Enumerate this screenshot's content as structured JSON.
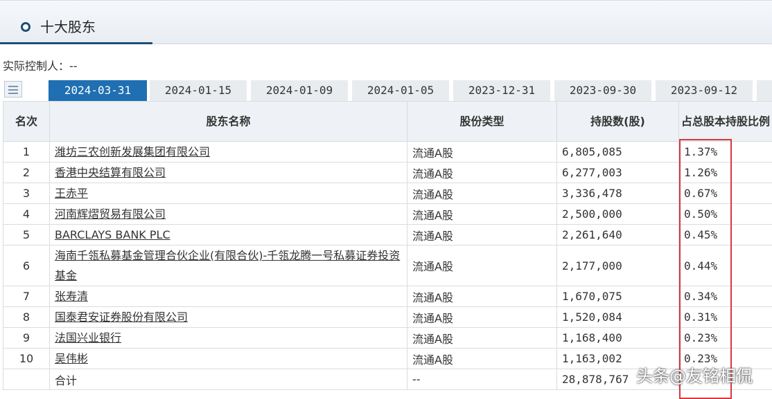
{
  "section": {
    "title": "十大股东"
  },
  "controller": "实际控制人：--",
  "tabs": [
    "2024-03-31",
    "2024-01-15",
    "2024-01-09",
    "2024-01-05",
    "2023-12-31",
    "2023-09-30",
    "2023-09-12"
  ],
  "active_tab": "2024-03-31",
  "table": {
    "headers": {
      "rank": "名次",
      "name": "股东名称",
      "type": "股份类型",
      "shares": "持股数(股)",
      "ratio": "占总股本持股比例"
    },
    "rows": [
      {
        "rank": "1",
        "name": "潍坊三农创新发展集团有限公司",
        "type": "流通A股",
        "shares": "6,805,085",
        "ratio": "1.37%"
      },
      {
        "rank": "2",
        "name": "香港中央结算有限公司",
        "type": "流通A股",
        "shares": "6,277,003",
        "ratio": "1.26%"
      },
      {
        "rank": "3",
        "name": "王赤平",
        "type": "流通A股",
        "shares": "3,336,478",
        "ratio": "0.67%"
      },
      {
        "rank": "4",
        "name": "河南辉熠贸易有限公司",
        "type": "流通A股",
        "shares": "2,500,000",
        "ratio": "0.50%"
      },
      {
        "rank": "5",
        "name": "BARCLAYS BANK PLC",
        "type": "流通A股",
        "shares": "2,261,640",
        "ratio": "0.45%"
      },
      {
        "rank": "6",
        "name": "海南千瓴私募基金管理合伙企业(有限合伙)-千瓴龙腾一号私募证券投资基金",
        "type": "流通A股",
        "shares": "2,177,000",
        "ratio": "0.44%"
      },
      {
        "rank": "7",
        "name": "张寿清",
        "type": "流通A股",
        "shares": "1,670,075",
        "ratio": "0.34%"
      },
      {
        "rank": "8",
        "name": "国泰君安证券股份有限公司",
        "type": "流通A股",
        "shares": "1,520,084",
        "ratio": "0.31%"
      },
      {
        "rank": "9",
        "name": "法国兴业银行",
        "type": "流通A股",
        "shares": "1,168,400",
        "ratio": "0.23%"
      },
      {
        "rank": "10",
        "name": "吴伟彬",
        "type": "流通A股",
        "shares": "1,163,002",
        "ratio": "0.23%"
      }
    ],
    "total": {
      "label": "合计",
      "type": "--",
      "shares": "28,878,767",
      "ratio": ""
    }
  },
  "watermark": "头条@友铭相侃",
  "colors": {
    "active_tab": "#1f6fb2",
    "highlight": "#d9363e",
    "header_accent": "#1f4e79"
  }
}
